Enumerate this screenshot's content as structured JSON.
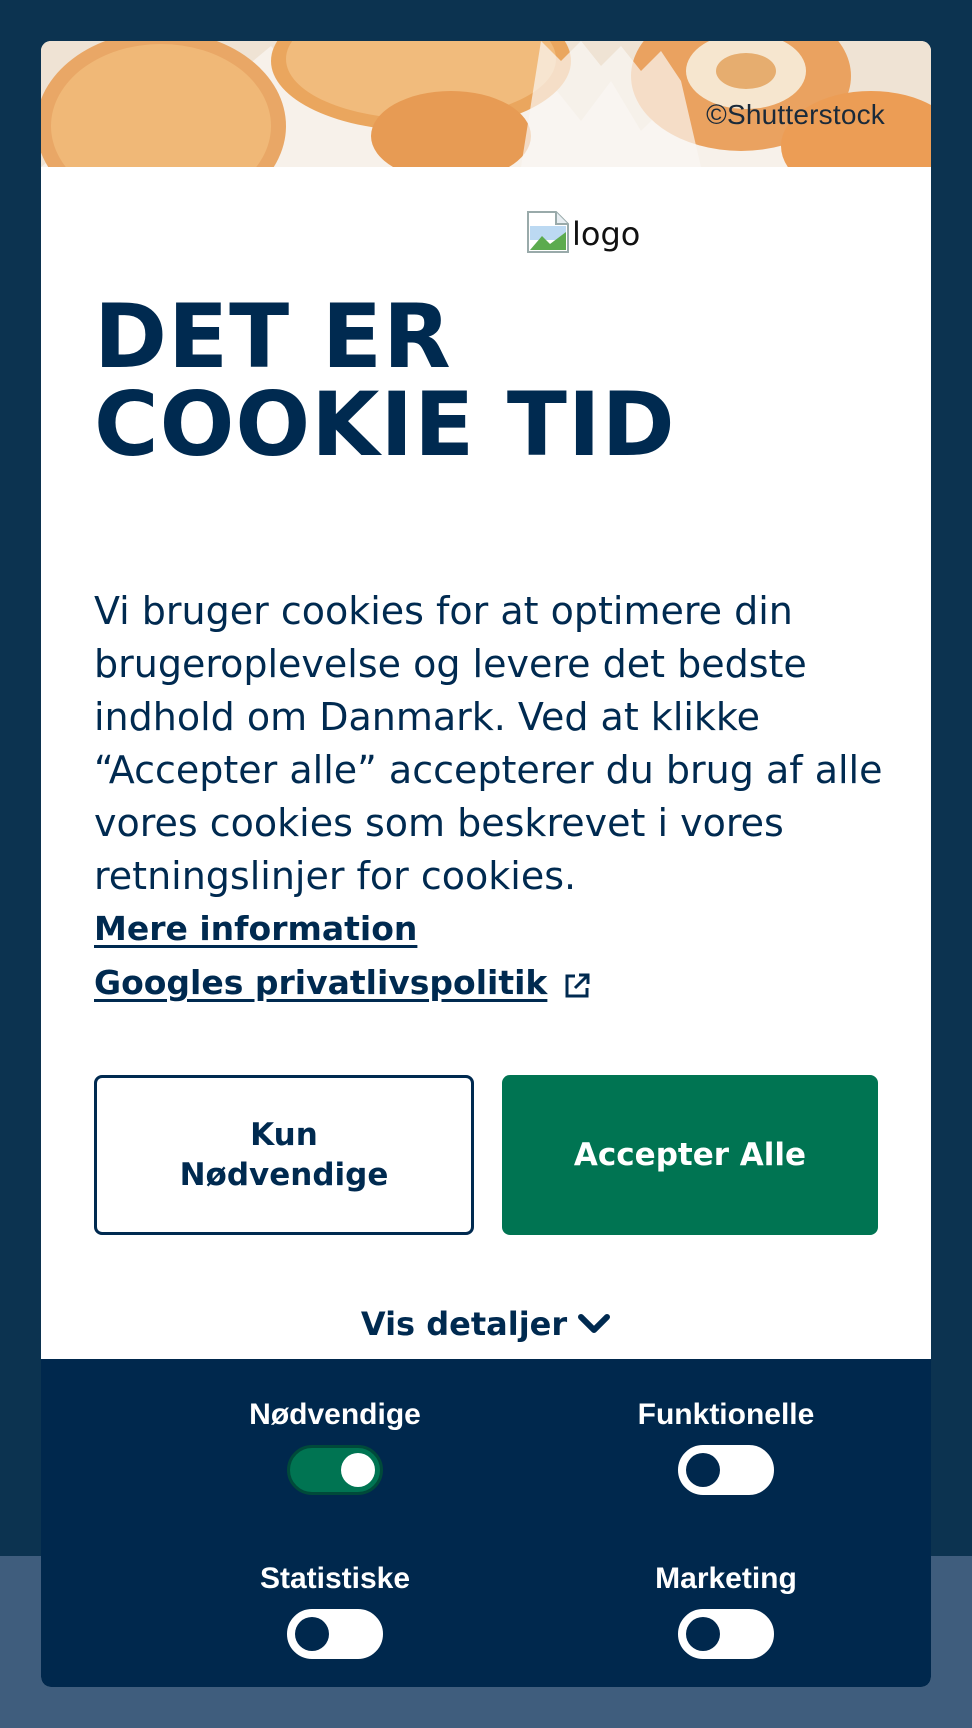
{
  "hero": {
    "credit": "©Shutterstock"
  },
  "logo": {
    "alt": "logo"
  },
  "title": {
    "line1": "DET ER",
    "line2": "COOKIE TID"
  },
  "body_text": "Vi bruger cookies for at optimere din brugeroplevelse og levere det bedste indhold om Danmark. Ved at klikke “Accepter alle” accepterer du brug af alle vores cookies som beskrevet i vores retningslinjer for cookies.",
  "links": {
    "more_info": "Mere information",
    "google_privacy": "Googles privatlivspolitik"
  },
  "buttons": {
    "necessary_line1": "Kun",
    "necessary_line2": "Nødvendige",
    "accept_all": "Accepter Alle"
  },
  "details_toggle": {
    "label": "Vis detaljer",
    "icon": "chevron-down-icon"
  },
  "toggles": [
    {
      "label": "Nødvendige",
      "enabled": true
    },
    {
      "label": "Funktionelle",
      "enabled": false
    },
    {
      "label": "Statistiske",
      "enabled": false
    },
    {
      "label": "Marketing",
      "enabled": false
    }
  ],
  "colors": {
    "navy": "#002a50",
    "accept_green": "#007452",
    "page_background": "#0c3350",
    "panel_background": "#00284d"
  }
}
